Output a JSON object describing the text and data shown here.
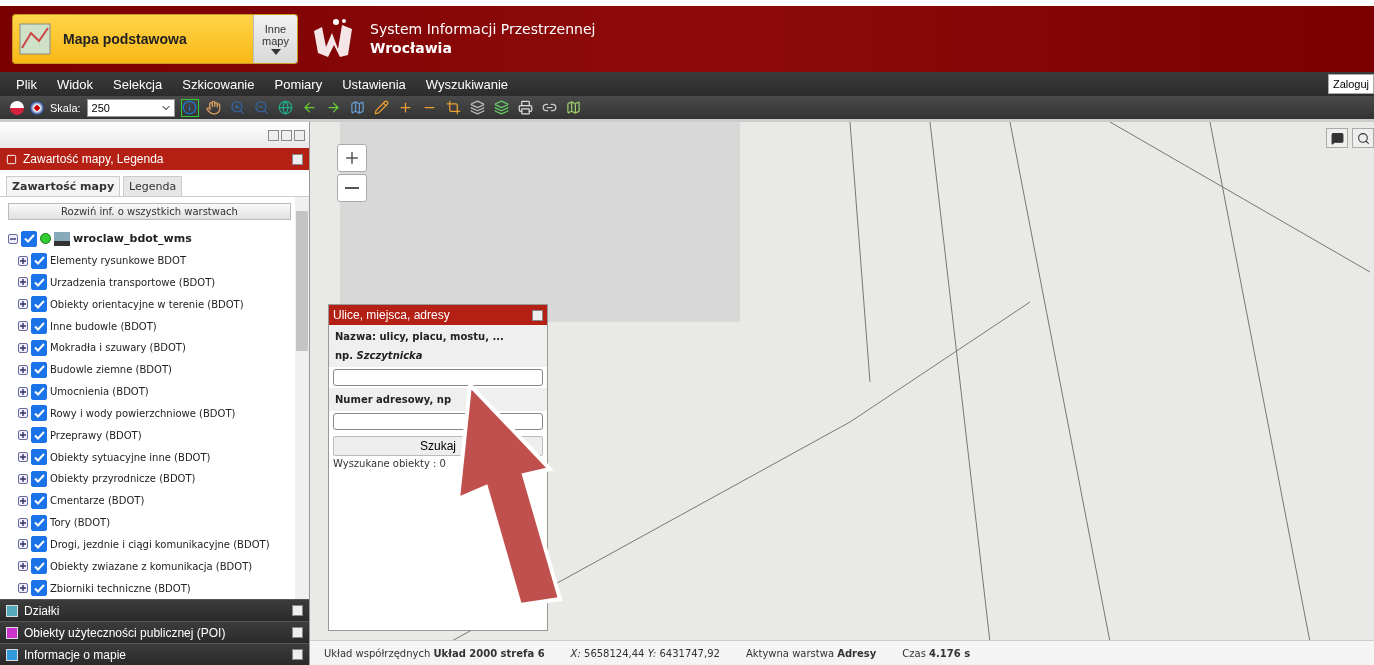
{
  "header": {
    "basemap": {
      "label": "Mapa podstawowa"
    },
    "other_maps": {
      "label": "Inne mapy"
    },
    "title_line_1": "System Informacji Przestrzennej",
    "title_line_2": "Wrocławia"
  },
  "menu": {
    "items": [
      "Plik",
      "Widok",
      "Selekcja",
      "Szkicowanie",
      "Pomiary",
      "Ustawienia",
      "Wyszukiwanie"
    ],
    "login": "Zaloguj"
  },
  "toolbar": {
    "scale_label": "Skala:",
    "scale_value": "250"
  },
  "sidebar": {
    "panel_title": "Zawartość mapy, Legenda",
    "tabs": [
      {
        "label": "Zawartość mapy",
        "selected": true
      },
      {
        "label": "Legenda",
        "selected": false
      }
    ],
    "expand_button": "Rozwiń inf. o wszystkich warstwach",
    "tree": [
      {
        "label": "wroclaw_bdot_wms",
        "checked": true,
        "expanded": true,
        "children": [
          {
            "label": "Elementy rysunkowe BDOT",
            "checked": true,
            "expanded": false
          },
          {
            "label": "Urzadzenia transportowe (BDOT)",
            "checked": true,
            "expanded": false
          },
          {
            "label": "Obiekty orientacyjne w terenie (BDOT)",
            "checked": true,
            "expanded": false
          },
          {
            "label": "Inne budowle (BDOT)",
            "checked": true,
            "expanded": false
          },
          {
            "label": "Mokradła i szuwary (BDOT)",
            "checked": true,
            "expanded": false
          },
          {
            "label": "Budowle ziemne (BDOT)",
            "checked": true,
            "expanded": false
          },
          {
            "label": "Umocnienia (BDOT)",
            "checked": true,
            "expanded": false
          },
          {
            "label": "Rowy i wody powierzchniowe (BDOT)",
            "checked": true,
            "expanded": false
          },
          {
            "label": "Przeprawy (BDOT)",
            "checked": true,
            "expanded": false
          },
          {
            "label": "Obiekty sytuacyjne inne (BDOT)",
            "checked": true,
            "expanded": false
          },
          {
            "label": "Obiekty przyrodnicze (BDOT)",
            "checked": true,
            "expanded": false
          },
          {
            "label": "Cmentarze (BDOT)",
            "checked": true,
            "expanded": false
          },
          {
            "label": "Tory (BDOT)",
            "checked": true,
            "expanded": false
          },
          {
            "label": "Drogi, jezdnie i ciągi komunikacyjne (BDOT)",
            "checked": true,
            "expanded": false
          },
          {
            "label": "Obiekty zwiazane z komunikacja (BDOT)",
            "checked": true,
            "expanded": false
          },
          {
            "label": "Zbiorniki techniczne (BDOT)",
            "checked": true,
            "expanded": false
          }
        ]
      }
    ],
    "sections": [
      {
        "label": "Działki",
        "kind": "parcels"
      },
      {
        "label": "Obiekty użyteczności publicznej (POI)",
        "kind": "poi"
      },
      {
        "label": "Informacje o mapie",
        "kind": "info"
      }
    ]
  },
  "search_dialog": {
    "title": "Ulice, miejsca, adresy",
    "name_label": "Nazwa: ulicy, placu, mostu, ...",
    "example": "np. *Szczytnicka*",
    "number_label": "Numer adresowy, np",
    "search_button": "Szukaj",
    "results": "Wyszukane obiekty : 0"
  },
  "status_bar": {
    "coords_system": "Układ współrzędnych **Układ 2000 strefa 6**",
    "coords": "*X:* 5658124,44 *Y:* 6431747,92",
    "active_layer": "Aktywna warstwa **Adresy**",
    "time": "Czas **4.176 s**"
  }
}
